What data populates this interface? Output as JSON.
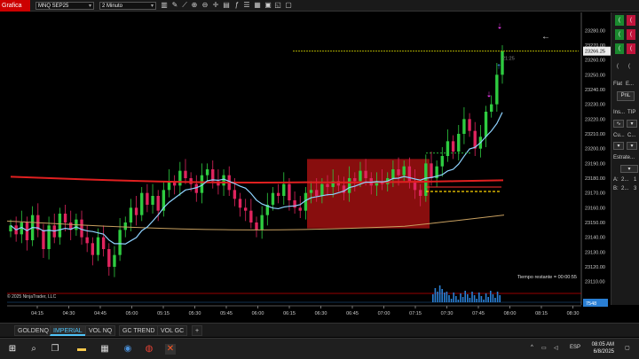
{
  "toolbar": {
    "app_title": "Grafica",
    "instrument": "MNQ SEP25",
    "interval": "2 Minuto"
  },
  "chart_data": {
    "type": "candlestick",
    "x_labels": [
      "04:15",
      "04:30",
      "04:45",
      "05:00",
      "05:15",
      "05:30",
      "05:45",
      "06:00",
      "06:15",
      "06:30",
      "06:45",
      "07:00",
      "07:15",
      "07:30",
      "07:45",
      "08:00",
      "08:15",
      "08:30"
    ],
    "y_ticks": [
      "23280.00",
      "23270.00",
      "23260.00",
      "23250.00",
      "23240.00",
      "23230.00",
      "23220.00",
      "23210.00",
      "23200.00",
      "23190.00",
      "23180.00",
      "23170.00",
      "23160.00",
      "23150.00",
      "23140.00",
      "23130.00",
      "23120.00",
      "23110.00"
    ],
    "y_range": [
      23105,
      23285
    ],
    "last_price": "23266.25",
    "time_marker": "21:25",
    "copyright": "© 2025 NinjaTrader, LLC",
    "time_remaining": "Tiempo restante = 00:00:55",
    "volume_label": "7548",
    "series": {
      "colors": {
        "up": "#2ecc40",
        "down": "#e0245e",
        "ma_fast": "#8fd3ff",
        "ma_slow": "#e02020",
        "ma_long": "#c8a060",
        "zone": "#a01010"
      },
      "close": [
        23148,
        23142,
        23150,
        23138,
        23155,
        23145,
        23132,
        23148,
        23140,
        23156,
        23150,
        23145,
        23152,
        23140,
        23136,
        23128,
        23140,
        23132,
        23120,
        23128,
        23145,
        23150,
        23160,
        23155,
        23170,
        23162,
        23168,
        23158,
        23172,
        23178,
        23175,
        23185,
        23180,
        23176,
        23170,
        23182,
        23186,
        23178,
        23175,
        23182,
        23172,
        23166,
        23160,
        23158,
        23150,
        23145,
        23155,
        23162,
        23170,
        23168,
        23176,
        23165,
        23160,
        23158,
        23170,
        23172,
        23168,
        23176,
        23174,
        23178,
        23175,
        23170,
        23180,
        23178,
        23185,
        23180,
        23175,
        23178,
        23176,
        23180,
        23186,
        23182,
        23188,
        23178,
        23172,
        23168,
        23190,
        23180,
        23188,
        23195,
        23205,
        23198,
        23210,
        23220,
        23212,
        23200,
        23208,
        23225,
        23230,
        23250,
        23266
      ]
    }
  },
  "right_panel": {
    "flat": "Flat",
    "e": "E...",
    "pnl": "PnL",
    "ins": "Ins...",
    "tip": "TIP",
    "cu": "Cu...",
    "c": "C...",
    "estrategia": "Estrate...",
    "a": "A:",
    "a_val": "2...",
    "a_num": "1",
    "b": "B:",
    "b_val": "2...",
    "b_num": "3"
  },
  "tabs": [
    {
      "label": "GOLDENQ"
    },
    {
      "label": "IMPERIAL"
    },
    {
      "label": "VOL NQ"
    },
    {
      "label": "GC TREND"
    },
    {
      "label": "VOL GC"
    },
    {
      "label": "+"
    }
  ],
  "taskbar": {
    "lang": "ESP",
    "time": "08:05 AM",
    "date": "6/8/2025"
  },
  "icons": [
    "windows-icon",
    "search-icon",
    "taskview-icon",
    "explorer-icon",
    "store-icon",
    "chrome-icon",
    "ninjatrader-icon"
  ]
}
